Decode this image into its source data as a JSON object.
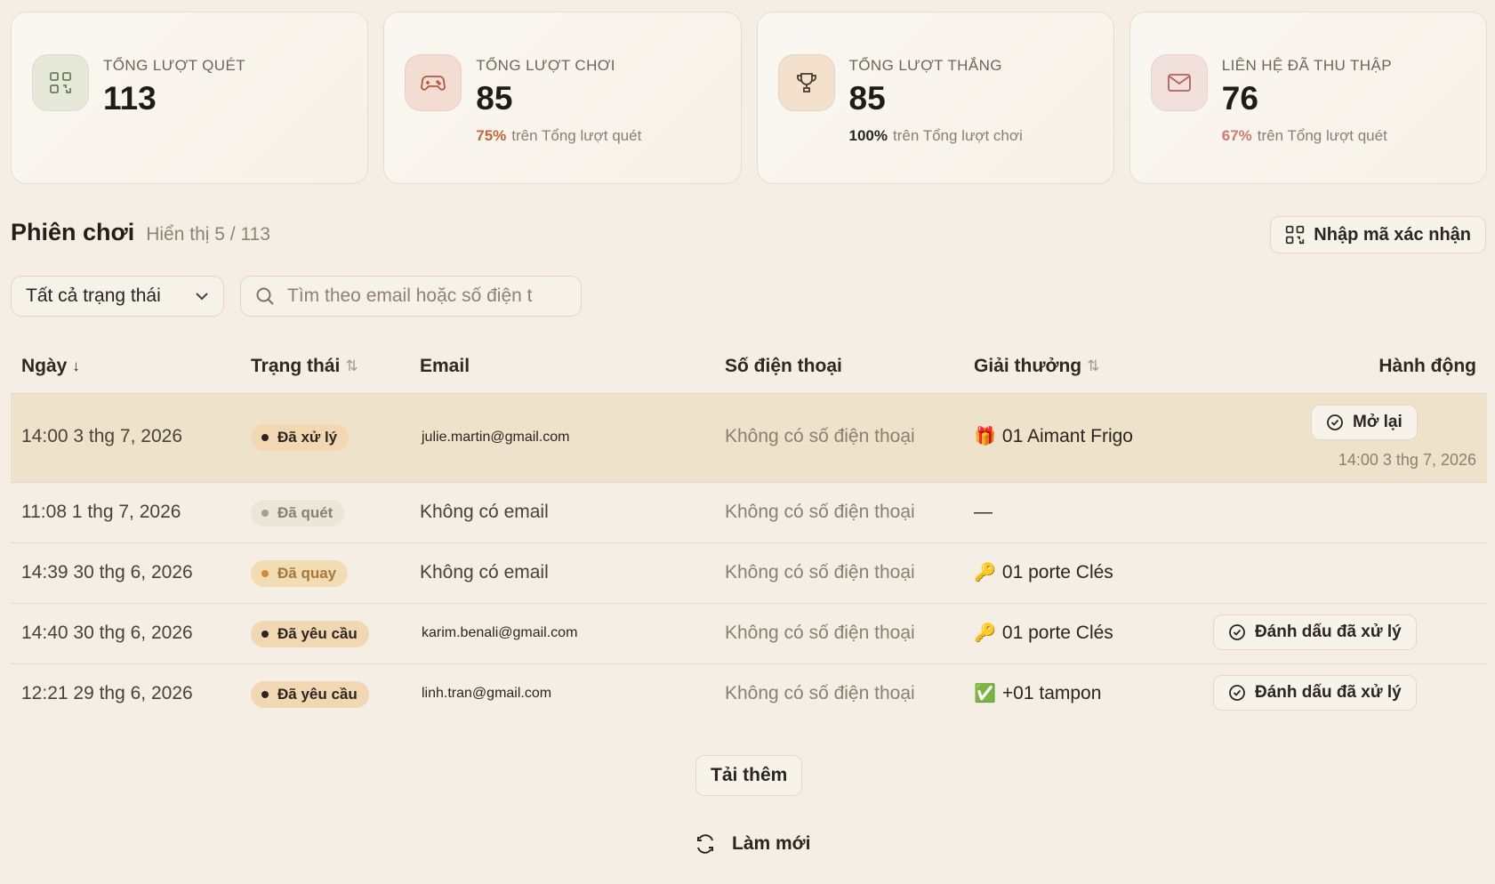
{
  "stats": [
    {
      "label": "TỔNG LƯỢT QUÉT",
      "value": "113",
      "sub_pct": "",
      "sub_text": "",
      "icon": "qr-code-icon",
      "icon_bg": "#e6e9d8",
      "icon_color": "#6f7b5a",
      "pct_color": "#c0673e"
    },
    {
      "label": "TỔNG LƯỢT CHƠI",
      "value": "85",
      "sub_pct": "75%",
      "sub_text": "trên Tổng lượt quét",
      "icon": "gamepad-icon",
      "icon_bg": "#f3dcd1",
      "icon_color": "#b05a3c",
      "pct_color": "#c0673e"
    },
    {
      "label": "TỔNG LƯỢT THẮNG",
      "value": "85",
      "sub_pct": "100%",
      "sub_text": "trên Tổng lượt chơi",
      "icon": "trophy-icon",
      "icon_bg": "#f3e1cd",
      "icon_color": "#4a3a2a",
      "pct_color": "#2b2520"
    },
    {
      "label": "LIÊN HỆ ĐÃ THU THẬP",
      "value": "76",
      "sub_pct": "67%",
      "sub_text": "trên Tổng lượt quét",
      "icon": "mail-icon",
      "icon_bg": "#f2e0dc",
      "icon_color": "#b0635a",
      "pct_color": "#cf7a6a"
    }
  ],
  "section": {
    "title": "Phiên chơi",
    "count": "Hiển thị 5 / 113",
    "confirm_button": "Nhập mã xác nhận"
  },
  "filters": {
    "status_select": "Tất cả trạng thái",
    "search_placeholder": "Tìm theo email hoặc số điện t"
  },
  "table": {
    "columns": {
      "date": "Ngày",
      "status": "Trạng thái",
      "email": "Email",
      "phone": "Số điện thoại",
      "prize": "Giải thưởng",
      "action": "Hành động"
    },
    "rows": [
      {
        "date": "14:00 3 thg 7, 2026",
        "status": "Đã xử lý",
        "status_color": "dark",
        "email": "julie.martin@gmail.com",
        "email_real": true,
        "phone": "Không có số điện thoại",
        "prize_emoji": "🎁",
        "prize": "01 Aimant Frigo",
        "action": "Mở lại",
        "action_date": "14:00 3 thg 7, 2026",
        "highlight": true
      },
      {
        "date": "11:08 1 thg 7, 2026",
        "status": "Đã quét",
        "status_color": "grey",
        "email": "Không có email",
        "email_real": false,
        "phone": "Không có số điện thoại",
        "prize_emoji": "",
        "prize": "—",
        "action": "",
        "action_date": "",
        "highlight": false
      },
      {
        "date": "14:39 30 thg 6, 2026",
        "status": "Đã quay",
        "status_color": "amber",
        "email": "Không có email",
        "email_real": false,
        "phone": "Không có số điện thoại",
        "prize_emoji": "🔑",
        "prize": "01 porte Clés",
        "action": "",
        "action_date": "",
        "highlight": false
      },
      {
        "date": "14:40 30 thg 6, 2026",
        "status": "Đã yêu cầu",
        "status_color": "dark",
        "email": "karim.benali@gmail.com",
        "email_real": true,
        "phone": "Không có số điện thoại",
        "prize_emoji": "🔑",
        "prize": "01 porte Clés",
        "action": "Đánh dấu đã xử lý",
        "action_date": "",
        "highlight": false
      },
      {
        "date": "12:21 29 thg 6, 2026",
        "status": "Đã yêu cầu",
        "status_color": "dark",
        "email": "linh.tran@gmail.com",
        "email_real": true,
        "phone": "Không có số điện thoại",
        "prize_emoji": "✅",
        "prize": "+01 tampon",
        "action": "Đánh dấu đã xử lý",
        "action_date": "",
        "highlight": false
      }
    ]
  },
  "footer": {
    "load_more": "Tải thêm",
    "refresh": "Làm mới"
  }
}
